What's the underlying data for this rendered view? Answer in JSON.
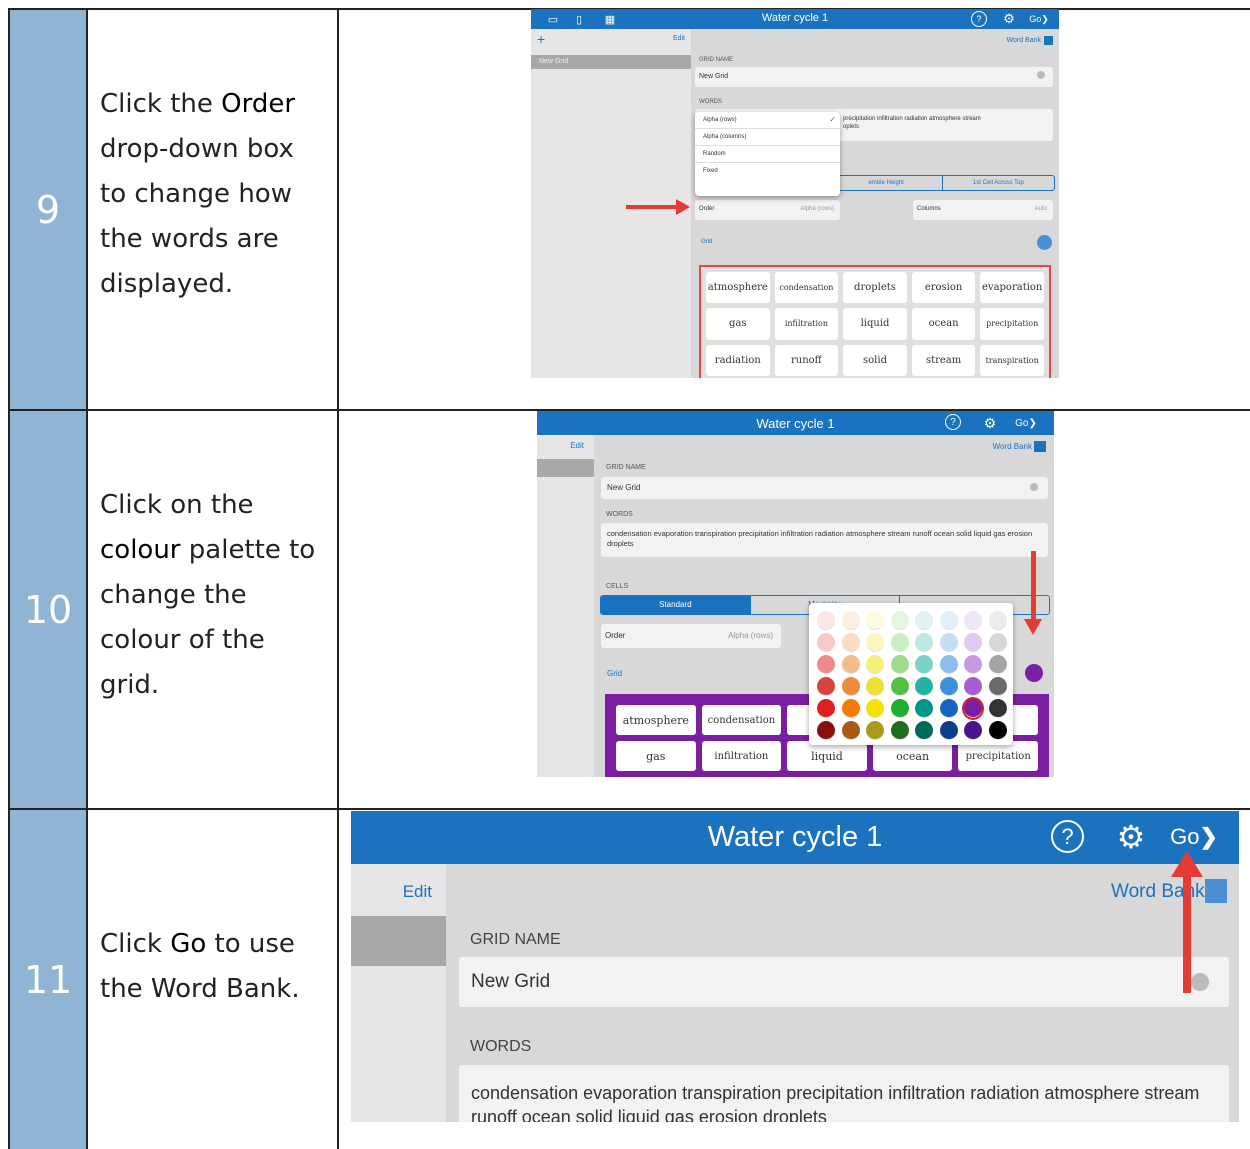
{
  "rows": [
    {
      "number": "9",
      "instruction": {
        "before": "Click the ",
        "highlight": "Order",
        "after": " drop-down box to change how the words are displayed."
      }
    },
    {
      "number": "10",
      "instruction": {
        "before": "Click on the ",
        "highlight": "colour",
        "after": " palette to change the colour of the grid."
      }
    },
    {
      "number": "11",
      "instruction": {
        "before": "Click ",
        "highlight": "Go",
        "after": " to use the Word Bank."
      }
    }
  ],
  "app": {
    "title": "Water cycle 1",
    "edit_label": "Edit",
    "help_icon": "?",
    "go_label": "Go",
    "word_bank_label": "Word Bank",
    "grid_name_label": "GRID NAME",
    "grid_name_value": "New Grid",
    "words_label": "WORDS",
    "words_value": "condensation evaporation transpiration precipitation infiltration radiation atmosphere stream runoff ocean solid liquid gas erosion droplets",
    "cells_label": "CELLS",
    "sidebar_item": "New Grid",
    "order_label": "Order",
    "order_value": "Alpha (rows)",
    "columns_label": "Columns",
    "columns_value": "Auto",
    "grid_label": "Grid",
    "cells_segments": [
      "Standard",
      "Maximize"
    ],
    "shot9_segments": [
      "emble Height",
      "1st Cell Across Top"
    ],
    "shot9_words_partial": "precipitation infiltration radiation atmosphere stream",
    "shot9_words_partial2": "oplets",
    "order_options": [
      "Alpha (rows)",
      "Alpha (columns)",
      "Random",
      "Fixed"
    ],
    "order_checkmark": "✓",
    "grid_words": [
      "atmosphere",
      "condensation",
      "droplets",
      "erosion",
      "evaporation",
      "gas",
      "infiltration",
      "liquid",
      "ocean",
      "precipitation",
      "radiation",
      "runoff",
      "solid",
      "stream",
      "transpiration"
    ],
    "shot10_row1": [
      "atmosphere",
      "condensation",
      "d",
      "",
      "ion"
    ],
    "shot10_row2": [
      "gas",
      "infiltration",
      "liquid",
      "ocean",
      "precipitation"
    ],
    "selected_color": "#7b1fa2",
    "accent_color": "#1b73c0"
  },
  "palette": [
    [
      "#fde6e6",
      "#fdeee2",
      "#fdfbe0",
      "#e6f6e2",
      "#e0f2f1",
      "#e3eefb",
      "#f1e6f7",
      "#ececec"
    ],
    [
      "#f9c9c9",
      "#f9dcc3",
      "#faf6bd",
      "#c9eec2",
      "#bde8e4",
      "#c4dcf6",
      "#e1c9ef",
      "#d7d7d7"
    ],
    [
      "#ef8a8a",
      "#f2bd8b",
      "#f5ef7b",
      "#9ddc8c",
      "#7cd3c9",
      "#8cbdee",
      "#c79ae0",
      "#a4a4a4"
    ],
    [
      "#d9453e",
      "#ec8c3b",
      "#eedf36",
      "#52c044",
      "#22b3a5",
      "#3e8fde",
      "#a95bd1",
      "#6b6b6b"
    ],
    [
      "#e21f1f",
      "#f57c00",
      "#f4e300",
      "#1fae2e",
      "#009688",
      "#1565c0",
      "#7b1fa2",
      "#333333"
    ],
    [
      "#8b0f0f",
      "#a85a13",
      "#a89a1a",
      "#1b6d1f",
      "#00695c",
      "#0d3c8a",
      "#4a148c",
      "#000000"
    ]
  ]
}
